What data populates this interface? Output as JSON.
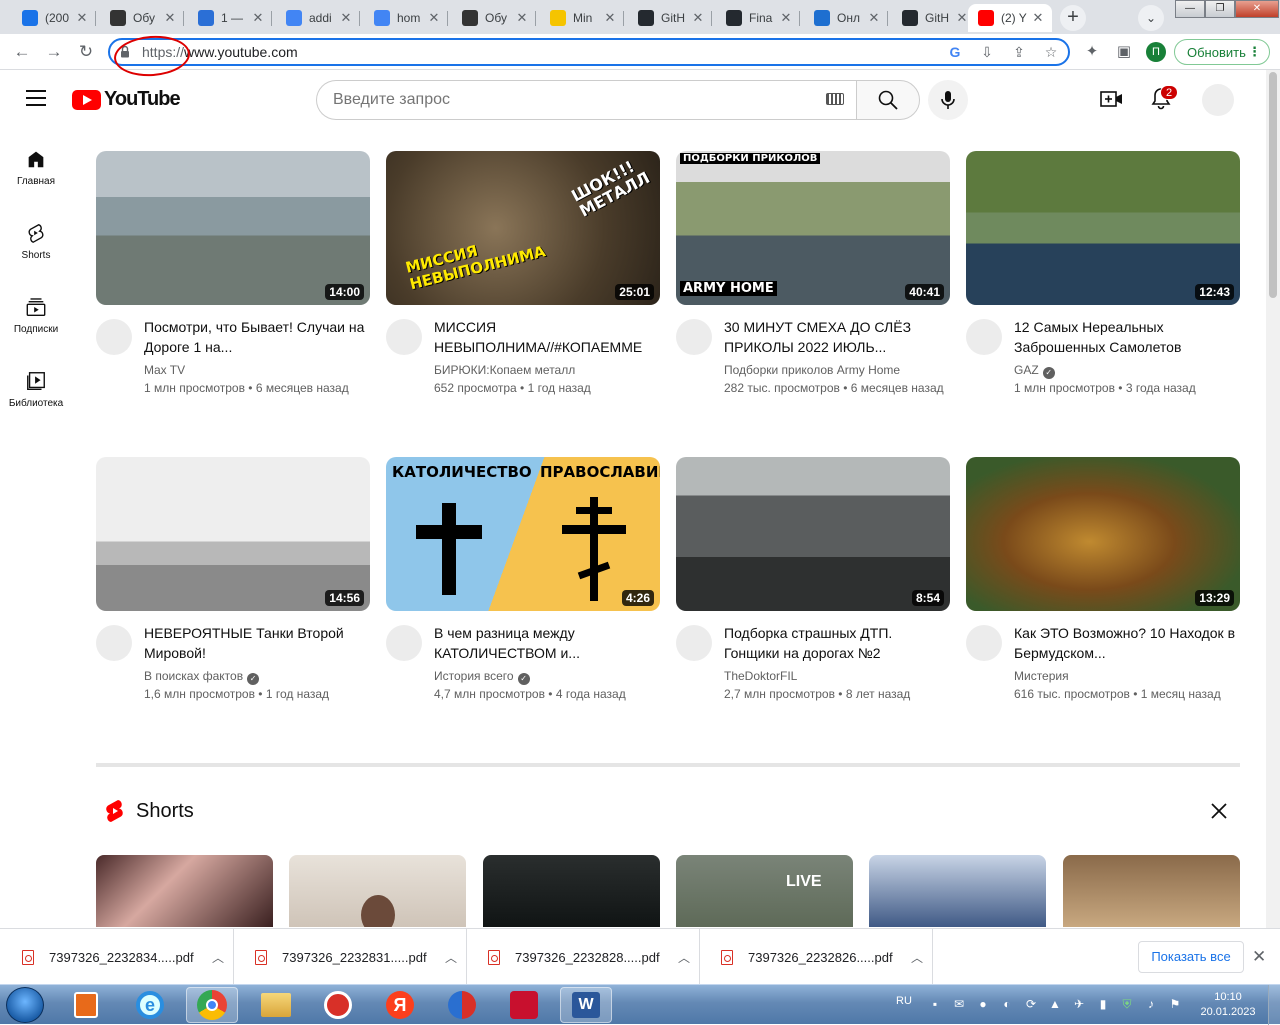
{
  "browser": {
    "tabs": [
      {
        "label": "(200",
        "favicon": "mail-icon",
        "color": "#1a73e8"
      },
      {
        "label": "Обу",
        "favicon": "openai-icon",
        "color": "#333333"
      },
      {
        "label": "1 —",
        "favicon": "edge-swirl-icon",
        "color": "#2b6fd6"
      },
      {
        "label": "addi",
        "favicon": "doc-icon",
        "color": "#4285f4"
      },
      {
        "label": "hom",
        "favicon": "doc-icon",
        "color": "#4285f4"
      },
      {
        "label": "Обу",
        "favicon": "openai-icon",
        "color": "#333333"
      },
      {
        "label": "Min",
        "favicon": "miro-icon",
        "color": "#f5c400"
      },
      {
        "label": "GitH",
        "favicon": "github-icon",
        "color": "#24292f"
      },
      {
        "label": "Fina",
        "favicon": "github-icon",
        "color": "#24292f"
      },
      {
        "label": "Онл",
        "favicon": "cloud-icon",
        "color": "#1e6fd0"
      },
      {
        "label": "GitH",
        "favicon": "github-icon",
        "color": "#24292f"
      },
      {
        "label": "(2) Y",
        "favicon": "youtube-icon",
        "color": "#ff0000"
      }
    ],
    "url_scheme": "https://",
    "url_host": "www.youtube.com",
    "profile_initial": "П",
    "update_label": "Обновить"
  },
  "youtube": {
    "logo_text": "YouTube",
    "search_placeholder": "Введите запрос",
    "notification_count": "2",
    "guide": [
      {
        "label": "Главная",
        "icon": "home-icon"
      },
      {
        "label": "Shorts",
        "icon": "shorts-icon"
      },
      {
        "label": "Подписки",
        "icon": "subscriptions-icon"
      },
      {
        "label": "Библиотека",
        "icon": "library-icon"
      }
    ],
    "videos": [
      {
        "title": "Посмотри, что Бывает! Случаи на Дороге 1 на...",
        "channel": "Max TV",
        "verified": false,
        "views": "1 млн просмотров",
        "age": "6 месяцев назад",
        "duration": "14:00",
        "overlay": ""
      },
      {
        "title": "МИССИЯ НЕВЫПОЛНИМА//#КОПАЕММЕ",
        "channel": "БИРЮКИ:Копаем металл",
        "verified": false,
        "views": "652 просмотра",
        "age": "1 год назад",
        "duration": "25:01",
        "overlay": "МИССИЯ НЕВЫПОЛНИМА",
        "overlay2": "ШОК!!! МЕТАЛЛ"
      },
      {
        "title": "30 МИНУТ СМЕХА ДО СЛЁЗ ПРИКОЛЫ 2022 ИЮЛЬ...",
        "channel": "Подборки приколов Army Home",
        "verified": false,
        "views": "282 тыс. просмотров",
        "age": "6 месяцев назад",
        "duration": "40:41",
        "overlay": "ПОДБОРКИ ПРИКОЛОВ",
        "overlay2": "ARMY HOME"
      },
      {
        "title": "12 Самых Нереальных Заброшенных Самолетов",
        "channel": "GAZ",
        "verified": true,
        "views": "1 млн просмотров",
        "age": "3 года назад",
        "duration": "12:43",
        "overlay": ""
      },
      {
        "title": "НЕВЕРОЯТНЫЕ Танки Второй Мировой!",
        "channel": "В поисках фактов",
        "verified": true,
        "views": "1,6 млн просмотров",
        "age": "1 год назад",
        "duration": "14:56",
        "overlay": ""
      },
      {
        "title": "В чем разница между КАТОЛИЧЕСТВОМ и...",
        "channel": "История всего",
        "verified": true,
        "views": "4,7 млн просмотров",
        "age": "4 года назад",
        "duration": "4:26",
        "overlay": "КАТОЛИЧЕСТВО",
        "overlay2": "ПРАВОСЛАВИЕ"
      },
      {
        "title": "Подборка страшных ДТП. Гонщики на дорогах №2",
        "channel": "TheDoktorFIL",
        "verified": false,
        "views": "2,7 млн просмотров",
        "age": "8 лет назад",
        "duration": "8:54",
        "overlay": ""
      },
      {
        "title": "Как ЭТО Возможно? 10 Находок в Бермудском...",
        "channel": "Мистерия",
        "verified": false,
        "views": "616 тыс. просмотров",
        "age": "1 месяц назад",
        "duration": "13:29",
        "overlay": ""
      }
    ],
    "shorts_title": "Shorts",
    "shorts_live_badge": "LIVE"
  },
  "downloads": {
    "files": [
      "7397326_2232834.....pdf",
      "7397326_2232831.....pdf",
      "7397326_2232828.....pdf",
      "7397326_2232826.....pdf"
    ],
    "show_all_label": "Показать все"
  },
  "taskbar": {
    "language": "RU",
    "time": "10:10",
    "date": "20.01.2023",
    "apps": [
      "media-player-icon",
      "ie-icon",
      "chrome-icon",
      "explorer-icon",
      "ccleaner-icon",
      "yandex-icon",
      "ccleaner-brush-icon",
      "acrobat-icon",
      "word-icon"
    ]
  }
}
